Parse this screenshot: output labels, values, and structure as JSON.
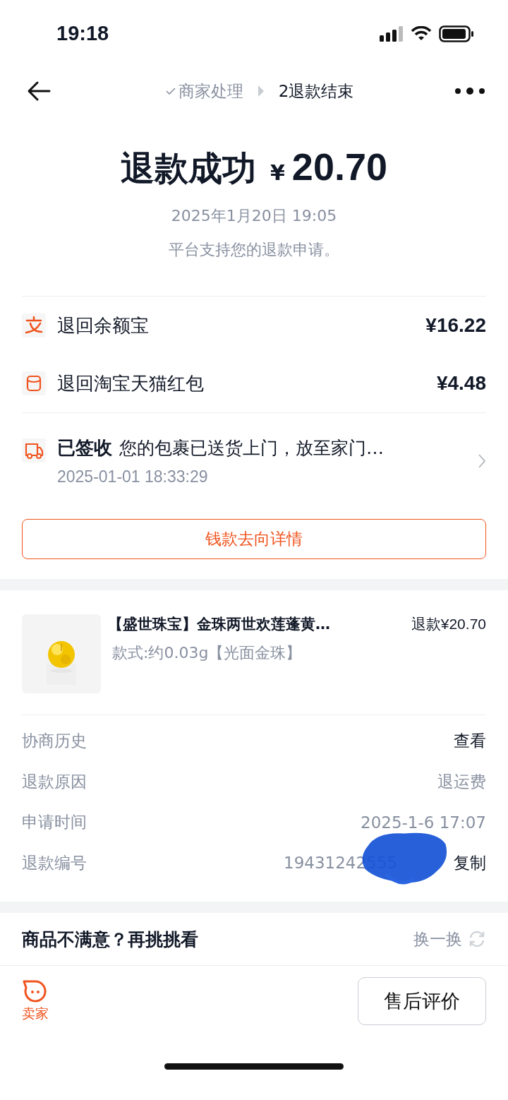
{
  "status_bar": {
    "time": "19:18"
  },
  "nav": {
    "steps": [
      {
        "label": "商家处理",
        "kind": "done"
      },
      {
        "label": "2退款结束",
        "kind": "current"
      }
    ]
  },
  "header": {
    "title": "退款成功",
    "currency": "¥",
    "amount": "20.70",
    "date": "2025年1月20日 19:05",
    "note": "平台支持您的退款申请。"
  },
  "refunds": [
    {
      "kind": "balance",
      "label": "退回余额宝",
      "amount": "¥16.22"
    },
    {
      "kind": "redpacket",
      "label": "退回淘宝天猫红包",
      "amount": "¥4.48"
    }
  ],
  "logistics": {
    "status": "已签收",
    "message": "您的包裹已送货上门，放至家门…",
    "time": "2025-01-01 18:33:29"
  },
  "money_button": "钱款去向详情",
  "product": {
    "title": "【盛世珠宝】金珠两世欢莲蓬黄…",
    "refund": "退款¥20.70",
    "spec": "款式:约0.03g【光面金珠】"
  },
  "details": [
    {
      "label": "协商历史",
      "value": "查看",
      "kind": "link"
    },
    {
      "label": "退款原因",
      "value": "退运费",
      "kind": "text"
    },
    {
      "label": "申请时间",
      "value": "2025-1-6 17:07",
      "kind": "text"
    },
    {
      "label": "退款编号",
      "value": "19431242555",
      "action": "复制",
      "kind": "copy"
    }
  ],
  "recommend": {
    "title": "商品不满意？再挑挑看",
    "refresh": "换一换"
  },
  "bottom_bar": {
    "seller": "卖家",
    "button": "售后评价"
  }
}
